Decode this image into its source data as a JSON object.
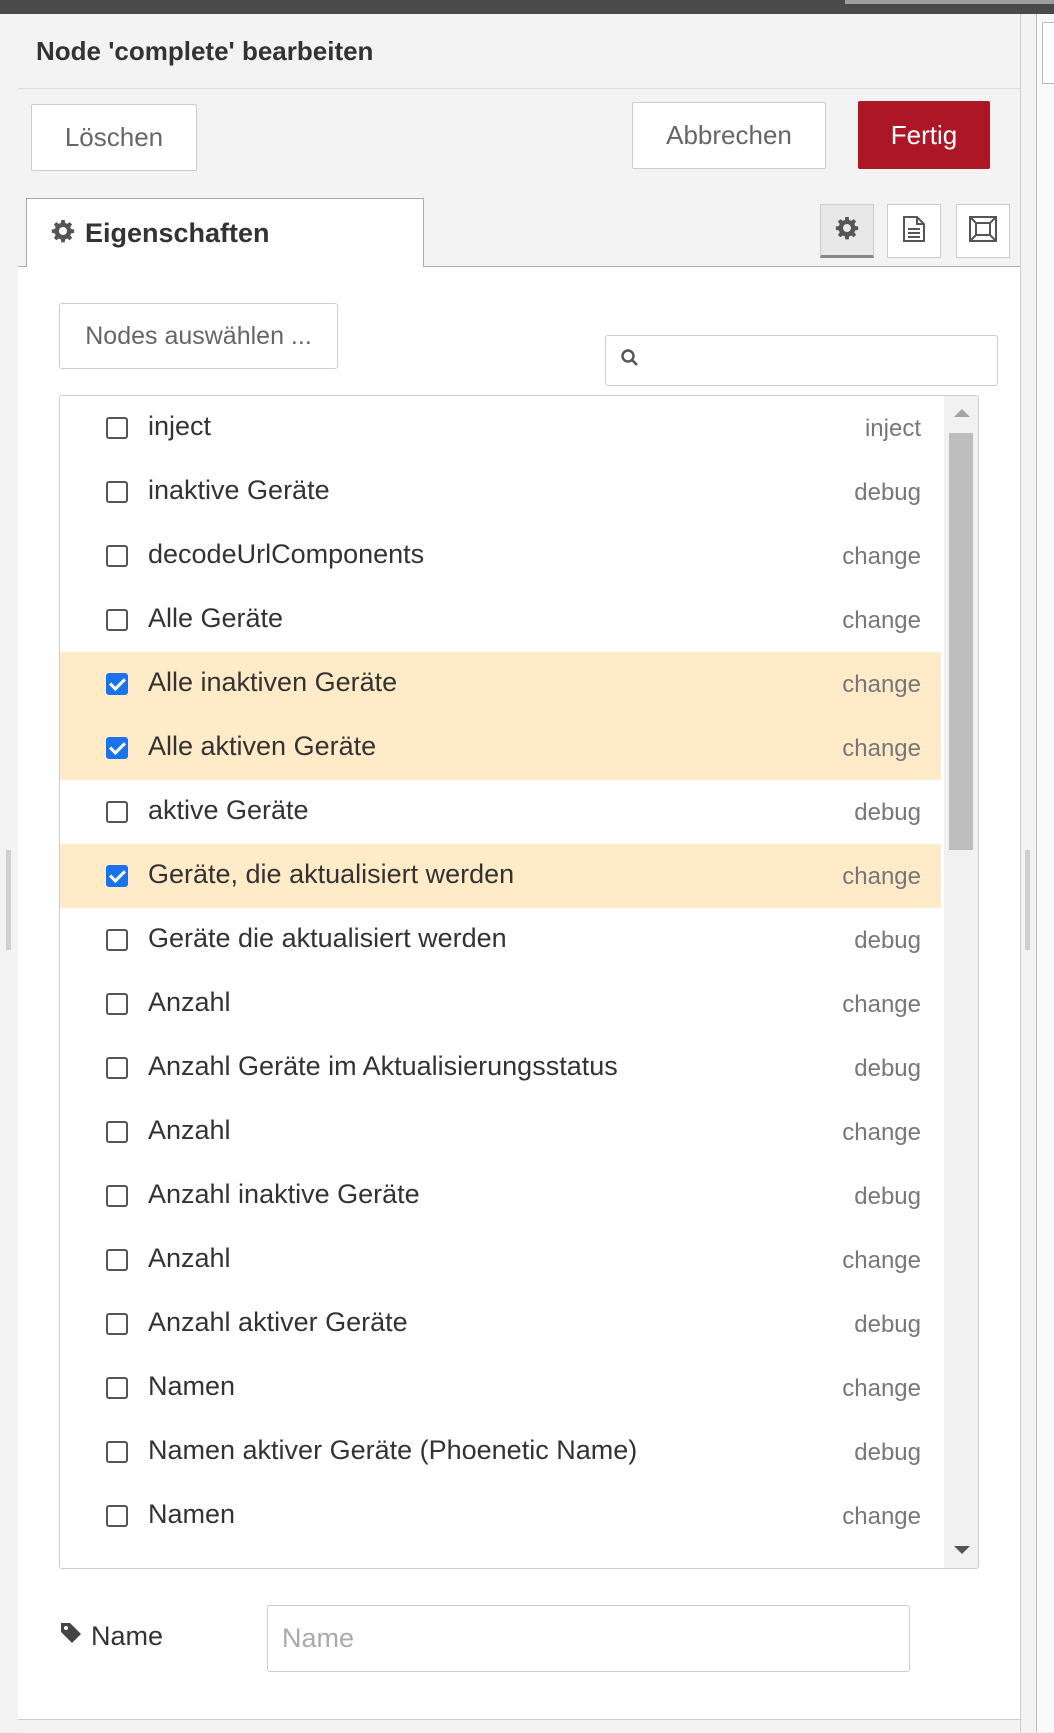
{
  "dialog": {
    "title": "Node 'complete' bearbeiten",
    "delete_label": "Löschen",
    "cancel_label": "Abbrechen",
    "done_label": "Fertig",
    "done_color": "#ad1625"
  },
  "tabs": {
    "properties_label": "Eigenschaften",
    "icons": [
      "gear-icon",
      "document-icon",
      "frame-icon"
    ]
  },
  "selector": {
    "select_nodes_label": "Nodes auswählen ...",
    "search_placeholder": ""
  },
  "nodes": [
    {
      "label": "inject",
      "type": "inject",
      "checked": false
    },
    {
      "label": "inaktive Geräte",
      "type": "debug",
      "checked": false
    },
    {
      "label": "decodeUrlComponents",
      "type": "change",
      "checked": false
    },
    {
      "label": "Alle Geräte",
      "type": "change",
      "checked": false
    },
    {
      "label": "Alle inaktiven Geräte",
      "type": "change",
      "checked": true
    },
    {
      "label": "Alle aktiven Geräte",
      "type": "change",
      "checked": true
    },
    {
      "label": "aktive Geräte",
      "type": "debug",
      "checked": false
    },
    {
      "label": "Geräte, die aktualisiert werden",
      "type": "change",
      "checked": true
    },
    {
      "label": "Geräte die aktualisiert werden",
      "type": "debug",
      "checked": false
    },
    {
      "label": "Anzahl",
      "type": "change",
      "checked": false
    },
    {
      "label": "Anzahl Geräte im Aktualisierungsstatus",
      "type": "debug",
      "checked": false
    },
    {
      "label": "Anzahl",
      "type": "change",
      "checked": false
    },
    {
      "label": "Anzahl inaktive Geräte",
      "type": "debug",
      "checked": false
    },
    {
      "label": "Anzahl",
      "type": "change",
      "checked": false
    },
    {
      "label": "Anzahl aktiver Geräte",
      "type": "debug",
      "checked": false
    },
    {
      "label": "Namen",
      "type": "change",
      "checked": false
    },
    {
      "label": "Namen aktiver Geräte (Phoenetic Name)",
      "type": "debug",
      "checked": false
    },
    {
      "label": "Namen",
      "type": "change",
      "checked": false
    }
  ],
  "name_field": {
    "label": "Name",
    "value": "",
    "placeholder": "Name"
  },
  "colors": {
    "selected_row": "#ffebc7",
    "checkbox_checked": "#1a73e8"
  }
}
